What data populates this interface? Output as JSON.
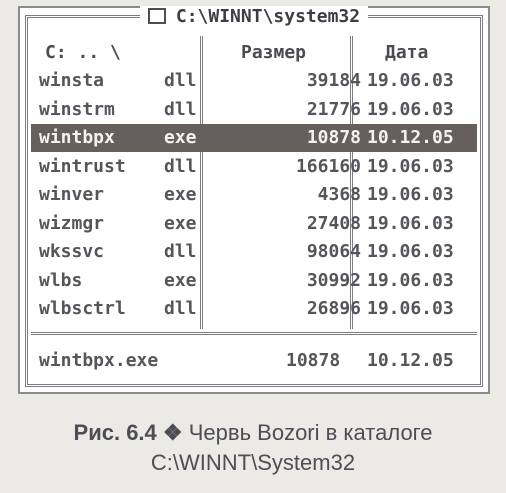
{
  "window": {
    "title": "C:\\WINNT\\system32"
  },
  "columns": {
    "path": "C: .. \\",
    "size": "Размер",
    "date": "Дата"
  },
  "files": [
    {
      "name": "winsta",
      "ext": "dll",
      "size": "39184",
      "date": "19.06.03",
      "selected": false
    },
    {
      "name": "winstrm",
      "ext": "dll",
      "size": "21776",
      "date": "19.06.03",
      "selected": false
    },
    {
      "name": "wintbpx",
      "ext": "exe",
      "size": "10878",
      "date": "10.12.05",
      "selected": true
    },
    {
      "name": "wintrust",
      "ext": "dll",
      "size": "166160",
      "date": "19.06.03",
      "selected": false
    },
    {
      "name": "winver",
      "ext": "exe",
      "size": "4368",
      "date": "19.06.03",
      "selected": false
    },
    {
      "name": "wizmgr",
      "ext": "exe",
      "size": "27408",
      "date": "19.06.03",
      "selected": false
    },
    {
      "name": "wkssvc",
      "ext": "dll",
      "size": "98064",
      "date": "19.06.03",
      "selected": false
    },
    {
      "name": "wlbs",
      "ext": "exe",
      "size": "30992",
      "date": "19.06.03",
      "selected": false
    },
    {
      "name": "wlbsctrl",
      "ext": "dll",
      "size": "26896",
      "date": "19.06.03",
      "selected": false
    }
  ],
  "status": {
    "filename": "wintbpx.exe",
    "size": "10878",
    "date": "10.12.05"
  },
  "caption": {
    "label": "Рис. 6.4",
    "symbol": "❖",
    "text": "Червь Bozori в каталоге",
    "line2": "C:\\WINNT\\System32"
  },
  "colors": {
    "selection": "#66605c",
    "frame": "#7c7c84"
  }
}
